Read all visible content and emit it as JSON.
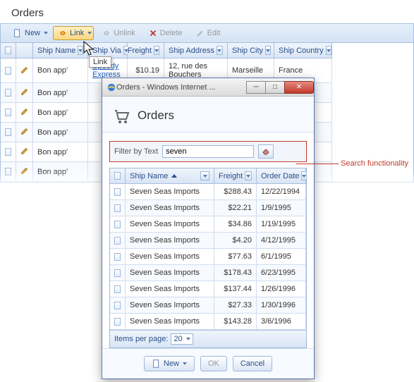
{
  "title": "Orders",
  "toolbar": {
    "new_label": "New",
    "link_label": "Link",
    "unlink_label": "Unlink",
    "delete_label": "Delete",
    "edit_label": "Edit"
  },
  "tooltip": "Link",
  "grid": {
    "headers": {
      "name": "Ship Name",
      "via": "Ship Via",
      "freight": "Freight",
      "addr": "Ship Address",
      "city": "Ship City",
      "country": "Ship Country"
    },
    "rows": [
      {
        "name": "Bon app'",
        "via": "Speedy Express",
        "freight": "$10.19",
        "addr": "12, rue des Bouchers",
        "city": "Marseille",
        "country": "France"
      },
      {
        "name": "Bon app'",
        "via": "",
        "freight": "",
        "addr": "",
        "city": "",
        "country": ""
      },
      {
        "name": "Bon app'",
        "via": "",
        "freight": "",
        "addr": "",
        "city": "",
        "country": ""
      },
      {
        "name": "Bon app'",
        "via": "",
        "freight": "",
        "addr": "",
        "city": "",
        "country": ""
      },
      {
        "name": "Bon app'",
        "via": "",
        "freight": "",
        "addr": "",
        "city": "",
        "country": ""
      },
      {
        "name": "Bon app'",
        "via": "",
        "freight": "",
        "addr": "",
        "city": "",
        "country": ""
      }
    ]
  },
  "popup": {
    "window_title": "Orders - Windows Internet ...",
    "title": "Orders",
    "search_label": "Filter by Text",
    "search_value": "seven",
    "headers": {
      "name": "Ship Name",
      "freight": "Freight",
      "date": "Order Date"
    },
    "rows": [
      {
        "name": "Seven Seas Imports",
        "freight": "$288.43",
        "date": "12/22/1994"
      },
      {
        "name": "Seven Seas Imports",
        "freight": "$22.21",
        "date": "1/9/1995"
      },
      {
        "name": "Seven Seas Imports",
        "freight": "$34.86",
        "date": "1/19/1995"
      },
      {
        "name": "Seven Seas Imports",
        "freight": "$4.20",
        "date": "4/12/1995"
      },
      {
        "name": "Seven Seas Imports",
        "freight": "$77.63",
        "date": "6/1/1995"
      },
      {
        "name": "Seven Seas Imports",
        "freight": "$178.43",
        "date": "6/23/1995"
      },
      {
        "name": "Seven Seas Imports",
        "freight": "$137.44",
        "date": "1/26/1996"
      },
      {
        "name": "Seven Seas Imports",
        "freight": "$27.33",
        "date": "1/30/1996"
      },
      {
        "name": "Seven Seas Imports",
        "freight": "$143.28",
        "date": "3/6/1996"
      }
    ],
    "pager_label": "Items per page:",
    "pager_value": "20",
    "new_label": "New",
    "ok_label": "OK",
    "cancel_label": "Cancel"
  },
  "callout": "Search functionality"
}
